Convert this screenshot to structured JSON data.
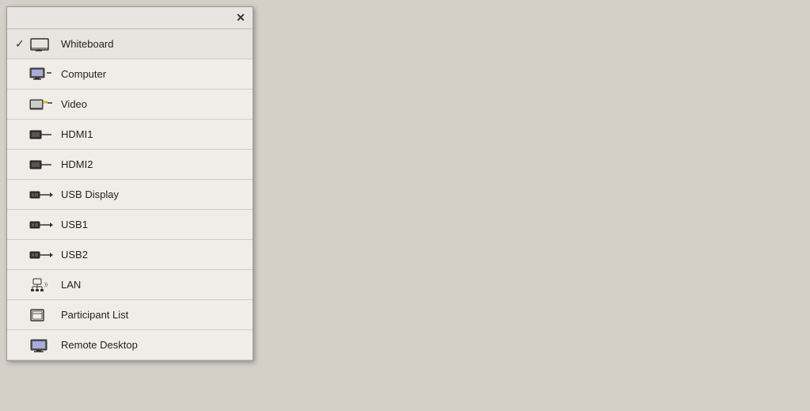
{
  "panel": {
    "close_label": "✕",
    "items": [
      {
        "id": "whiteboard",
        "label": "Whiteboard",
        "icon": "whiteboard",
        "selected": true
      },
      {
        "id": "computer",
        "label": "Computer",
        "icon": "computer",
        "selected": false
      },
      {
        "id": "video",
        "label": "Video",
        "icon": "video",
        "selected": false
      },
      {
        "id": "hdmi1",
        "label": "HDMI1",
        "icon": "hdmi",
        "selected": false
      },
      {
        "id": "hdmi2",
        "label": "HDMI2",
        "icon": "hdmi",
        "selected": false
      },
      {
        "id": "usb-display",
        "label": "USB Display",
        "icon": "usb",
        "selected": false
      },
      {
        "id": "usb1",
        "label": "USB1",
        "icon": "usb",
        "selected": false
      },
      {
        "id": "usb2",
        "label": "USB2",
        "icon": "usb",
        "selected": false
      },
      {
        "id": "lan",
        "label": "LAN",
        "icon": "lan",
        "selected": false
      },
      {
        "id": "participant-list",
        "label": "Participant List",
        "icon": "participant",
        "selected": false
      },
      {
        "id": "remote-desktop",
        "label": "Remote Desktop",
        "icon": "remote",
        "selected": false
      }
    ]
  }
}
